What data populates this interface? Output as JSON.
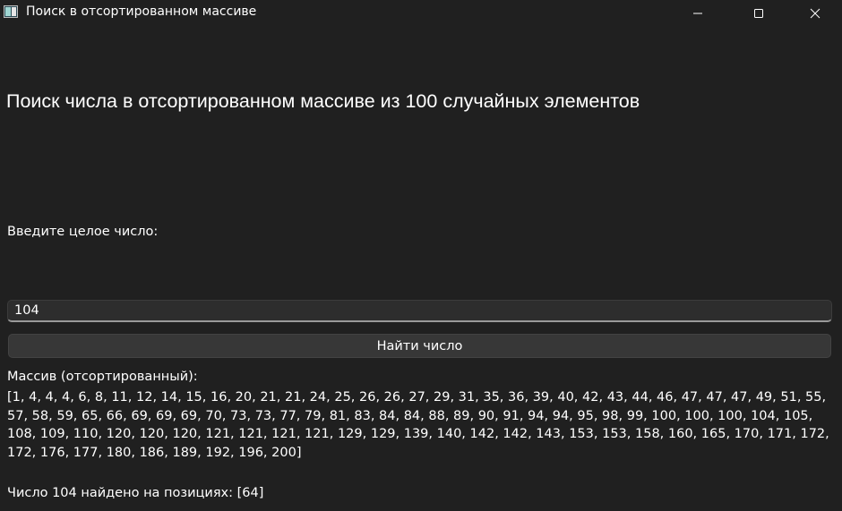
{
  "window": {
    "title": "Поиск в отсортированном массиве",
    "icon": "app-window-icon",
    "controls": [
      "minimize-icon",
      "maximize-icon",
      "close-icon"
    ]
  },
  "main": {
    "heading": "Поиск числа в отсортированном массиве из 100 случайных элементов",
    "prompt_label": "Введите целое число:",
    "input_value": "104",
    "find_button_label": "Найти число",
    "array_label": "Массив (отсортированный):",
    "array_values": "[1, 4, 4, 4, 6, 8, 11, 12, 14, 15, 16, 20, 21, 21, 24, 25, 26, 26, 27, 29, 31, 35, 36, 39, 40, 42, 43, 44, 46, 47, 47, 47, 49, 51, 55, 57, 58, 59, 65, 66, 69, 69, 69, 70, 73, 73, 77, 79, 81, 83, 84, 84, 88, 89, 90, 91, 94, 94, 95, 98, 99, 100, 100, 100, 104, 105, 108, 109, 110, 120, 120, 120, 121, 121, 121, 121, 129, 129, 139, 140, 142, 142, 143, 153, 153, 158, 160, 165, 170, 171, 172, 172, 176, 177, 180, 186, 189, 192, 196, 200]",
    "result_text": "Число 104 найдено на позициях: [64]"
  },
  "colors": {
    "background": "#202020",
    "text": "#ffffff",
    "input_background": "#2d2d2d",
    "button_background": "#373737"
  }
}
